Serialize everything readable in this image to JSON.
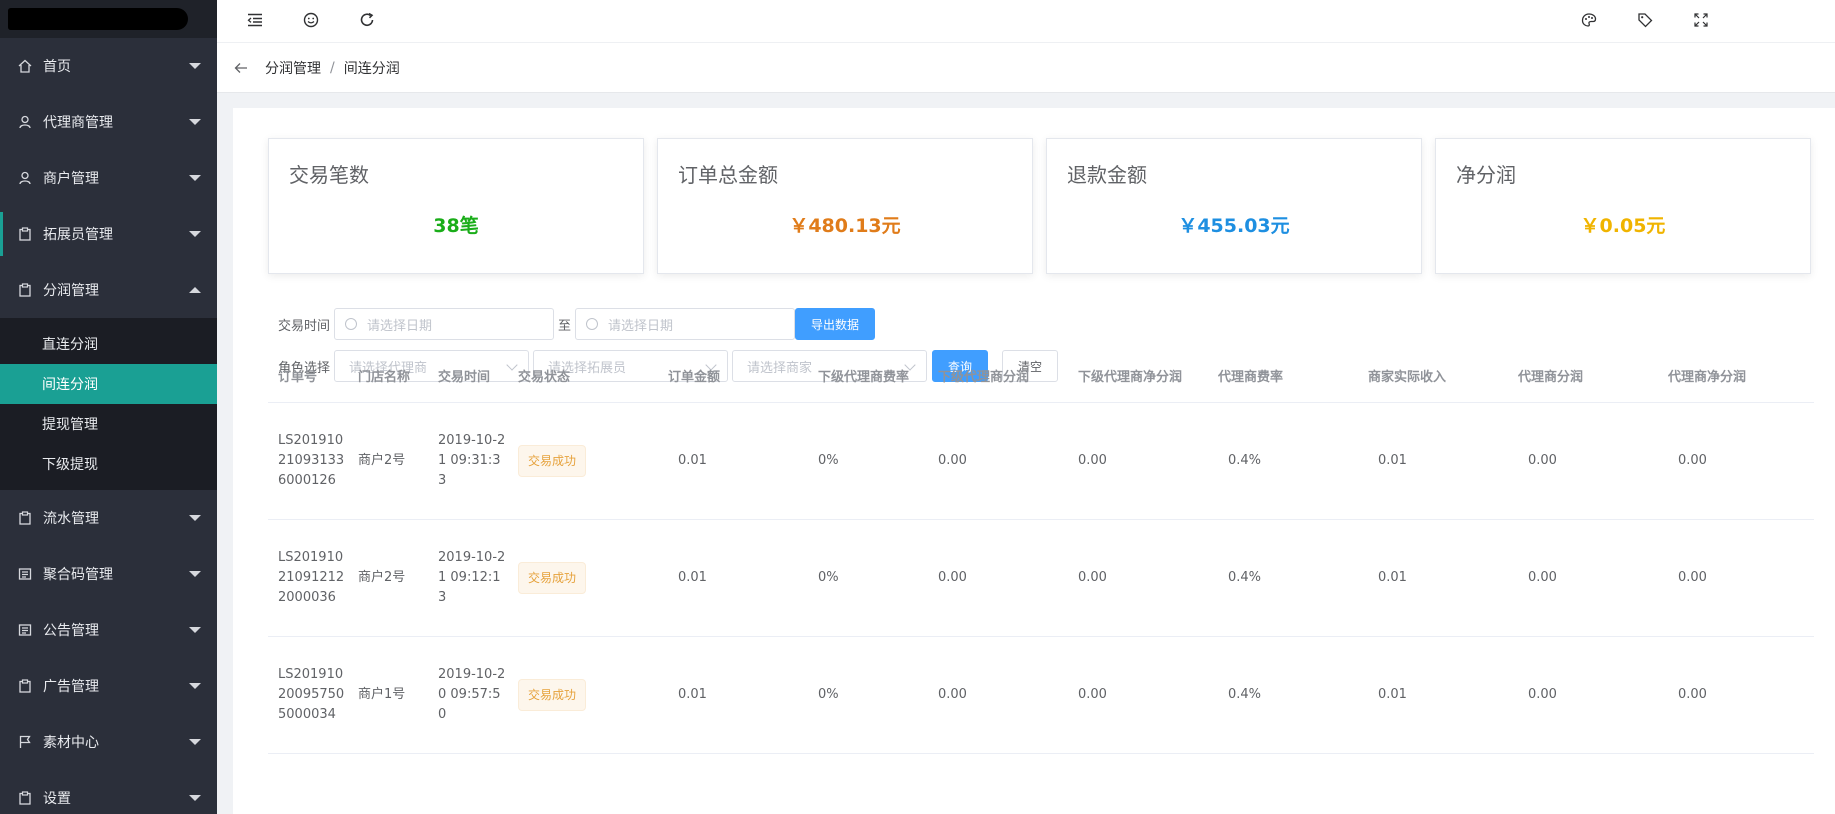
{
  "sidebar": {
    "items": [
      {
        "label": "首页",
        "icon": "home-icon"
      },
      {
        "label": "代理商管理",
        "icon": "user-icon"
      },
      {
        "label": "商户管理",
        "icon": "user-icon"
      },
      {
        "label": "拓展员管理",
        "icon": "clipboard-icon"
      },
      {
        "label": "分润管理",
        "icon": "clipboard-icon"
      }
    ],
    "submenu": [
      {
        "label": "直连分润"
      },
      {
        "label": "间连分润"
      },
      {
        "label": "提现管理"
      },
      {
        "label": "下级提现"
      }
    ],
    "items_after": [
      {
        "label": "流水管理",
        "icon": "clipboard-icon"
      },
      {
        "label": "聚合码管理",
        "icon": "qrcode-icon"
      },
      {
        "label": "公告管理",
        "icon": "notice-icon"
      },
      {
        "label": "广告管理",
        "icon": "clipboard-icon"
      },
      {
        "label": "素材中心",
        "icon": "flag-icon"
      },
      {
        "label": "设置",
        "icon": "clipboard-icon"
      }
    ],
    "accent_color": "#1aa094"
  },
  "breadcrumb": {
    "parent": "分润管理",
    "separator": "/",
    "current": "间连分润"
  },
  "cards": [
    {
      "title": "交易笔数",
      "value": "38笔",
      "color": "#1aad19"
    },
    {
      "title": "订单总金额",
      "value": "￥480.13元",
      "color": "#e07c1a"
    },
    {
      "title": "退款金额",
      "value": "￥455.03元",
      "color": "#1e8fe1"
    },
    {
      "title": "净分润",
      "value": "￥0.05元",
      "color": "#f0b400"
    }
  ],
  "filters": {
    "time_label": "交易时间",
    "date_placeholder_start": "请选择日期",
    "to": "至",
    "date_placeholder_end": "请选择日期",
    "export_button": "导出数据",
    "role_label": "角色选择",
    "agent_placeholder": "请选择代理商",
    "expander_placeholder": "请选择拓展员",
    "merchant_placeholder": "请选择商家",
    "query_button": "查询",
    "clear_button": "清空"
  },
  "table": {
    "columns": [
      "订单号",
      "门店名称",
      "交易时间",
      "交易状态",
      "订单金额",
      "下级代理商费率",
      "下级代理商分润",
      "下级代理商净分润",
      "代理商费率",
      "商家实际收入",
      "代理商分润",
      "代理商净分润"
    ],
    "rows": [
      {
        "order_no": "LS201910210931336000126",
        "store": "商户2号",
        "time": "2019-10-21 09:31:33",
        "status": "交易成功",
        "amount": "0.01",
        "sub_rate": "0%",
        "sub_share": "0.00",
        "sub_net": "0.00",
        "agent_rate": "0.4%",
        "merchant_income": "0.01",
        "agent_share": "0.00",
        "agent_net": "0.00"
      },
      {
        "order_no": "LS201910210912122000036",
        "store": "商户2号",
        "time": "2019-10-21 09:12:13",
        "status": "交易成功",
        "amount": "0.01",
        "sub_rate": "0%",
        "sub_share": "0.00",
        "sub_net": "0.00",
        "agent_rate": "0.4%",
        "merchant_income": "0.01",
        "agent_share": "0.00",
        "agent_net": "0.00"
      },
      {
        "order_no": "LS201910200957505000034",
        "store": "商户1号",
        "time": "2019-10-20 09:57:50",
        "status": "交易成功",
        "amount": "0.01",
        "sub_rate": "0%",
        "sub_share": "0.00",
        "sub_net": "0.00",
        "agent_rate": "0.4%",
        "merchant_income": "0.01",
        "agent_share": "0.00",
        "agent_net": "0.00"
      }
    ]
  },
  "colors": {
    "primary": "#409eff",
    "sidebar_bg": "#2b2f3a",
    "tag_text": "#e6a23c"
  }
}
